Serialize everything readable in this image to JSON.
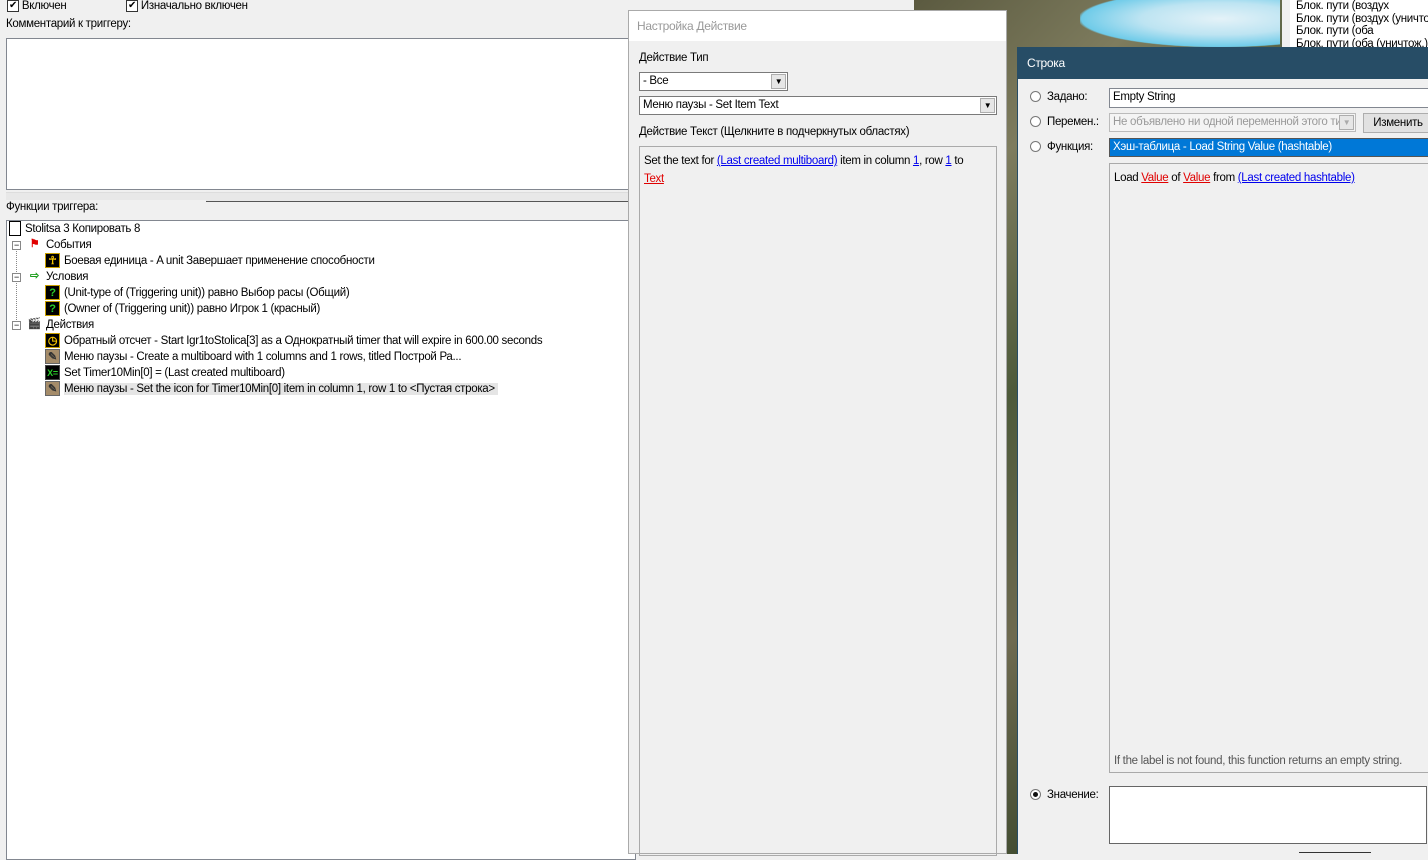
{
  "trigger": {
    "enabled_label": "Включен",
    "initially_on_label": "Изначально включен",
    "comment_label": "Комментарий к триггеру:",
    "functions_label": "Функции триггера:",
    "tree": {
      "root": "Stolitsa 3 Копировать 8",
      "events_label": "События",
      "events": [
        "Боевая единица - A unit Завершает применение способности"
      ],
      "conditions_label": "Условия",
      "conditions": [
        "(Unit-type of (Triggering unit)) равно Выбор расы (Общий)",
        "(Owner of (Triggering unit)) равно Игрок 1 (красный)"
      ],
      "actions_label": "Действия",
      "actions": [
        "Обратный отсчет - Start Igr1toStolica[3] as a Однократный timer that will expire in 600.00 seconds",
        "Меню паузы - Create a multiboard with 1 columns and 1 rows, titled Построй Ра...",
        "Set Timer10Min[0] = (Last created multiboard)",
        "Меню паузы - Set the icon for Timer10Min[0] item in column 1, row 1 to <Пустая строка>"
      ]
    }
  },
  "action_dialog": {
    "title": "Настройка Действие",
    "type_label": "Действие Тип",
    "type_value": "- Все",
    "action_value": "Меню паузы - Set Item Text",
    "text_label": "Действие Текст (Щелкните в подчеркнутых областях)",
    "text": {
      "p1": "Set the text for ",
      "l1": "(Last created multiboard)",
      "p2": " item in column ",
      "l2": "1",
      "p3": ", row ",
      "l3": "1",
      "p4": " to",
      "l4": "Text"
    }
  },
  "map_list": [
    "Блок. пути (воздух",
    "Блок. пути (воздух (уничтож",
    "Блок. пути (оба",
    "Блок. пути (оба (уничтож.)"
  ],
  "string_dialog": {
    "title": "Строка",
    "preset_label": "Задано:",
    "preset_value": "Empty String",
    "variable_label": "Перемен.:",
    "variable_value": "Не объявлено ни одной переменной этого типа",
    "edit_button": "Изменить",
    "function_label": "Функция:",
    "function_value": "Хэш-таблица - Load String Value (hashtable)",
    "function_text": {
      "p1": "Load ",
      "l1": "Value",
      "p2": " of ",
      "l2": "Value",
      "p3": " from ",
      "l3": "(Last created hashtable)"
    },
    "hint": "If the label is not found, this function returns an empty string.",
    "value_label": "Значение:",
    "value": ""
  }
}
